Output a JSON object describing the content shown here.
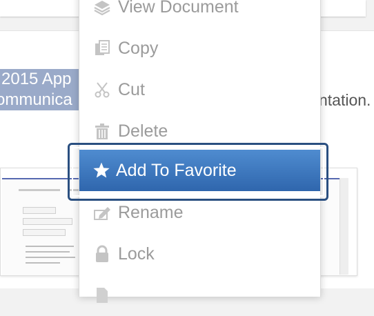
{
  "background": {
    "title_lines": [
      "2015 App",
      "ommunica"
    ],
    "description": "ntation.",
    "highlight_color": "#9aaac9"
  },
  "context_menu": {
    "items": [
      {
        "label": "View Document",
        "icon": "layers-icon"
      },
      {
        "label": "Copy",
        "icon": "copy-icon"
      },
      {
        "label": "Cut",
        "icon": "scissors-icon"
      },
      {
        "label": "Delete",
        "icon": "trash-icon"
      },
      {
        "label": "Add To Favorite",
        "icon": "star-icon",
        "highlighted": true
      },
      {
        "label": "Rename",
        "icon": "rename-icon"
      },
      {
        "label": "Lock",
        "icon": "lock-icon"
      },
      {
        "label": "",
        "icon": "document-icon"
      }
    ],
    "highlight_color": "#3b76bd",
    "focus_ring_color": "#2a4f80",
    "item_text_color": "#9b9b9b"
  }
}
